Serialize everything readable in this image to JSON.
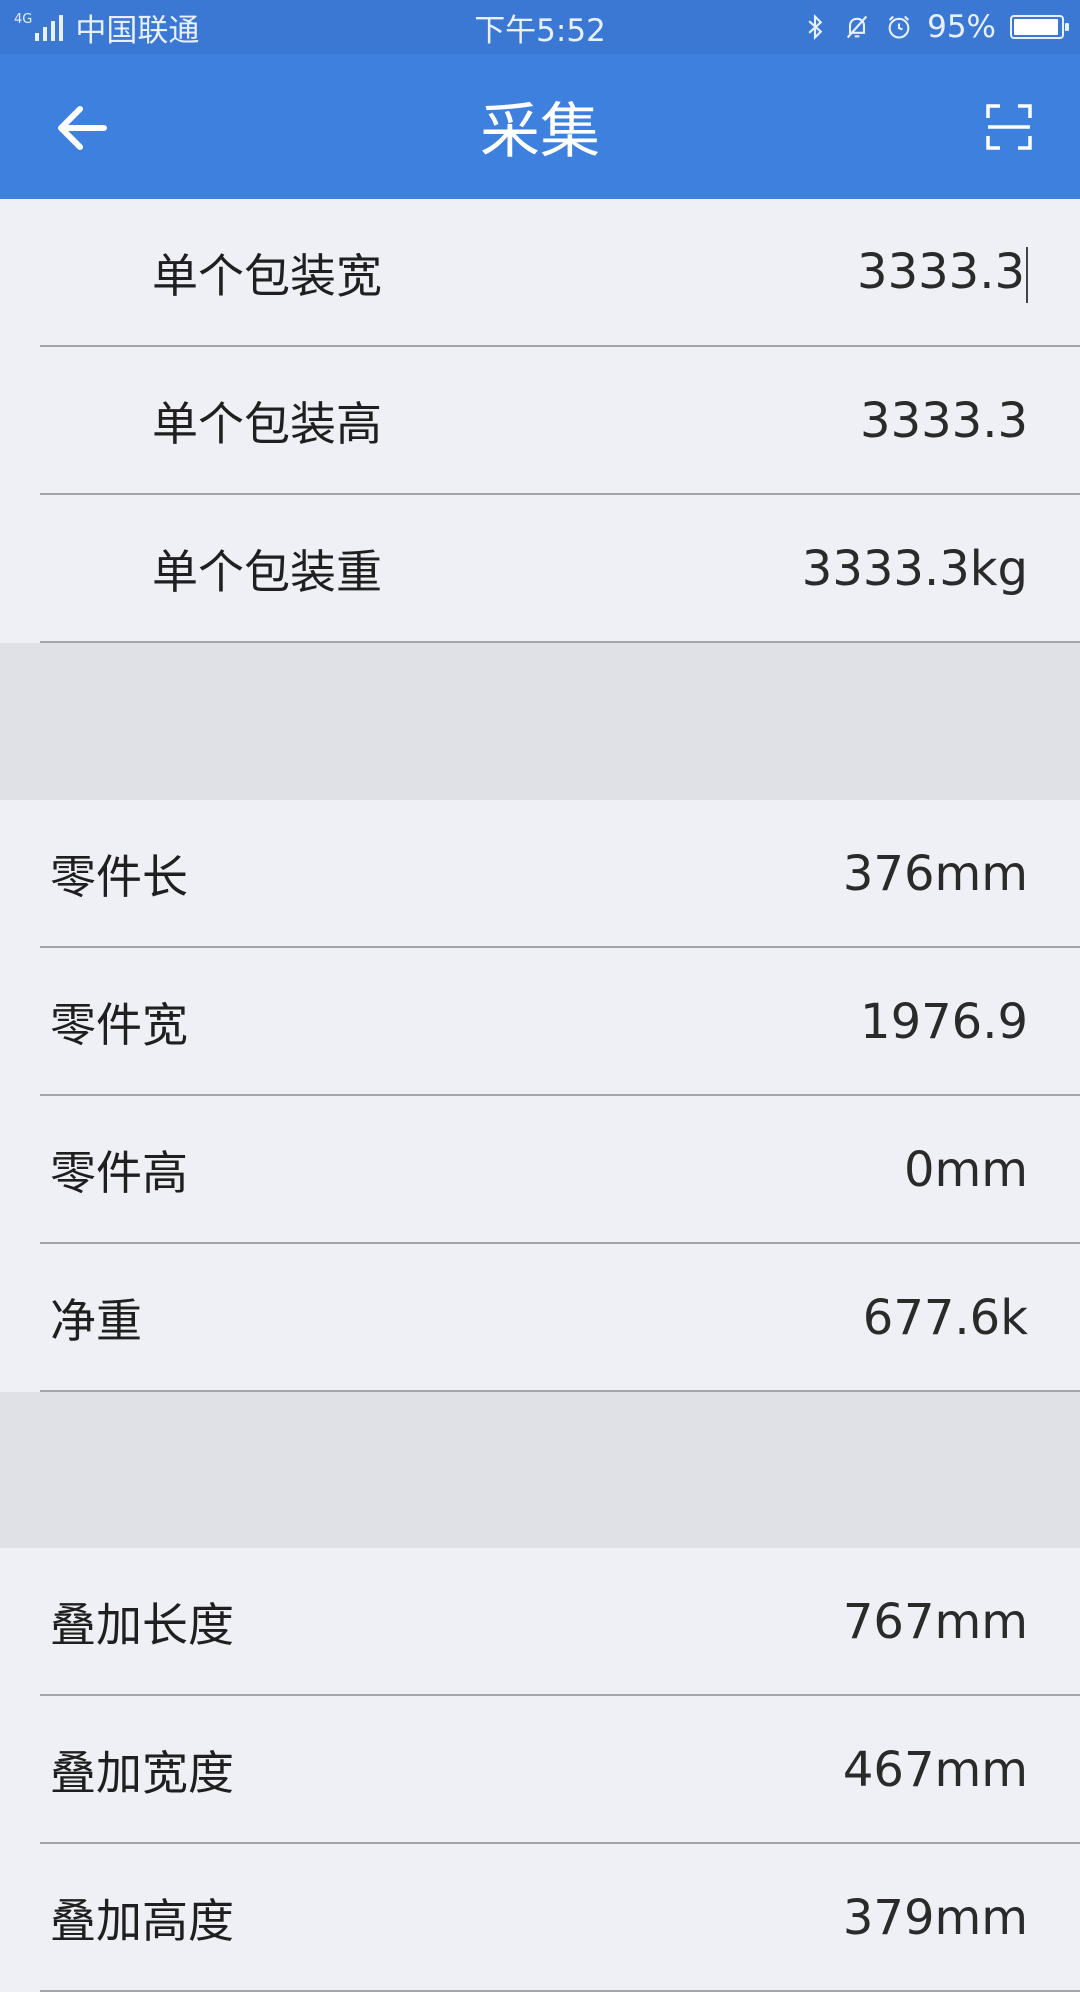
{
  "status_bar": {
    "network": "4G",
    "carrier": "中国联通",
    "time": "下午5:52",
    "battery_text": "95%",
    "battery_level": 0.95,
    "icons": [
      "bluetooth-icon",
      "bell-off-icon",
      "alarm-icon"
    ]
  },
  "nav": {
    "title": "采集",
    "back_icon": "back-arrow-icon",
    "scan_icon": "scan-icon"
  },
  "package_section": [
    {
      "label": "单个包装宽",
      "value": "3333.3",
      "focused": true
    },
    {
      "label": "单个包装高",
      "value": "3333.3"
    },
    {
      "label": "单个包装重",
      "value": "3333.3kg"
    }
  ],
  "part_section": [
    {
      "label": "零件长",
      "value": "376mm"
    },
    {
      "label": "零件宽",
      "value": "1976.9"
    },
    {
      "label": "零件高",
      "value": "0mm"
    },
    {
      "label": "净重",
      "value": "677.6k"
    }
  ],
  "stack_section": [
    {
      "label": "叠加长度",
      "value": "767mm"
    },
    {
      "label": "叠加宽度",
      "value": "467mm"
    },
    {
      "label": "叠加高度",
      "value": "379mm"
    }
  ],
  "colors": {
    "nav_blue": "#3d80dd",
    "status_blue": "#3a78d4",
    "background": "#eff0f5",
    "separator_band": "#e0e1e6"
  }
}
